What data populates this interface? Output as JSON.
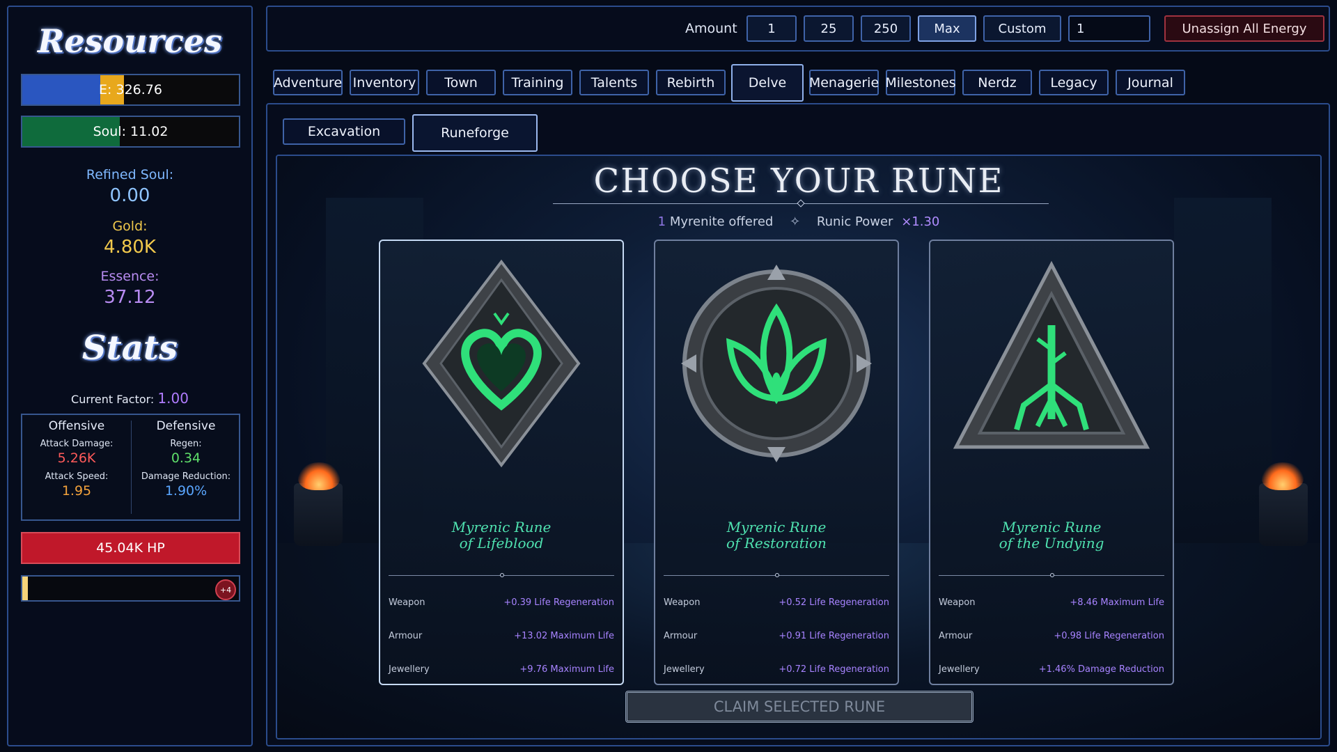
{
  "resources": {
    "title": "Resources",
    "energy_label": "E: 326.76",
    "soul_label": "Soul: 11.02",
    "refined_soul_label": "Refined Soul:",
    "refined_soul_value": "0.00",
    "gold_label": "Gold:",
    "gold_value": "4.80K",
    "essence_label": "Essence:",
    "essence_value": "37.12"
  },
  "stats": {
    "title": "Stats",
    "current_factor_label": "Current Factor:",
    "current_factor_value": "1.00",
    "offensive": {
      "heading": "Offensive",
      "attack_damage_label": "Attack Damage:",
      "attack_damage_value": "5.26K",
      "attack_speed_label": "Attack Speed:",
      "attack_speed_value": "1.95"
    },
    "defensive": {
      "heading": "Defensive",
      "regen_label": "Regen:",
      "regen_value": "0.34",
      "damage_reduction_label": "Damage Reduction:",
      "damage_reduction_value": "1.90%"
    },
    "hp_label": "45.04K HP",
    "level_badge": "+4"
  },
  "amount_bar": {
    "label": "Amount",
    "options": [
      "1",
      "25",
      "250",
      "Max",
      "Custom"
    ],
    "active": "Max",
    "custom_value": "1",
    "unassign_label": "Unassign All Energy"
  },
  "tabs": [
    "Adventure",
    "Inventory",
    "Town",
    "Training",
    "Talents",
    "Rebirth",
    "Delve",
    "Menagerie",
    "Milestones",
    "Nerdz",
    "Legacy",
    "Journal"
  ],
  "active_tab": "Delve",
  "subtabs": [
    "Excavation",
    "Runeforge"
  ],
  "active_subtab": "Runeforge",
  "runeforge": {
    "title": "CHOOSE YOUR RUNE",
    "offer_count": "1",
    "offer_text": "Myrenite offered",
    "separator": "✧",
    "power_label": "Runic Power",
    "power_value": "×1.30",
    "claim_label": "CLAIM SELECTED RUNE",
    "cards": [
      {
        "name_line1": "Myrenic Rune",
        "name_line2": "of Lifeblood",
        "shape": "diamond-heart",
        "rows": [
          {
            "slot": "Weapon",
            "bonus": "+0.39 Life Regeneration"
          },
          {
            "slot": "Armour",
            "bonus": "+13.02 Maximum Life"
          },
          {
            "slot": "Jewellery",
            "bonus": "+9.76 Maximum Life"
          }
        ]
      },
      {
        "name_line1": "Myrenic Rune",
        "name_line2": "of Restoration",
        "shape": "round-lotus",
        "rows": [
          {
            "slot": "Weapon",
            "bonus": "+0.52 Life Regeneration"
          },
          {
            "slot": "Armour",
            "bonus": "+0.91 Life Regeneration"
          },
          {
            "slot": "Jewellery",
            "bonus": "+0.72 Life Regeneration"
          }
        ]
      },
      {
        "name_line1": "Myrenic Rune",
        "name_line2": "of the Undying",
        "shape": "triangle-root",
        "rows": [
          {
            "slot": "Weapon",
            "bonus": "+8.46 Maximum Life"
          },
          {
            "slot": "Armour",
            "bonus": "+0.98 Life Regeneration"
          },
          {
            "slot": "Jewellery",
            "bonus": "+1.46% Damage Reduction"
          }
        ]
      }
    ]
  },
  "colors": {
    "energy_fill": "#2a56c0",
    "energy_reserved": "#e8a81c",
    "soul_fill": "#0f6b3c",
    "rune_glow": "#2fe07a",
    "bonus_text": "#a783ff"
  }
}
